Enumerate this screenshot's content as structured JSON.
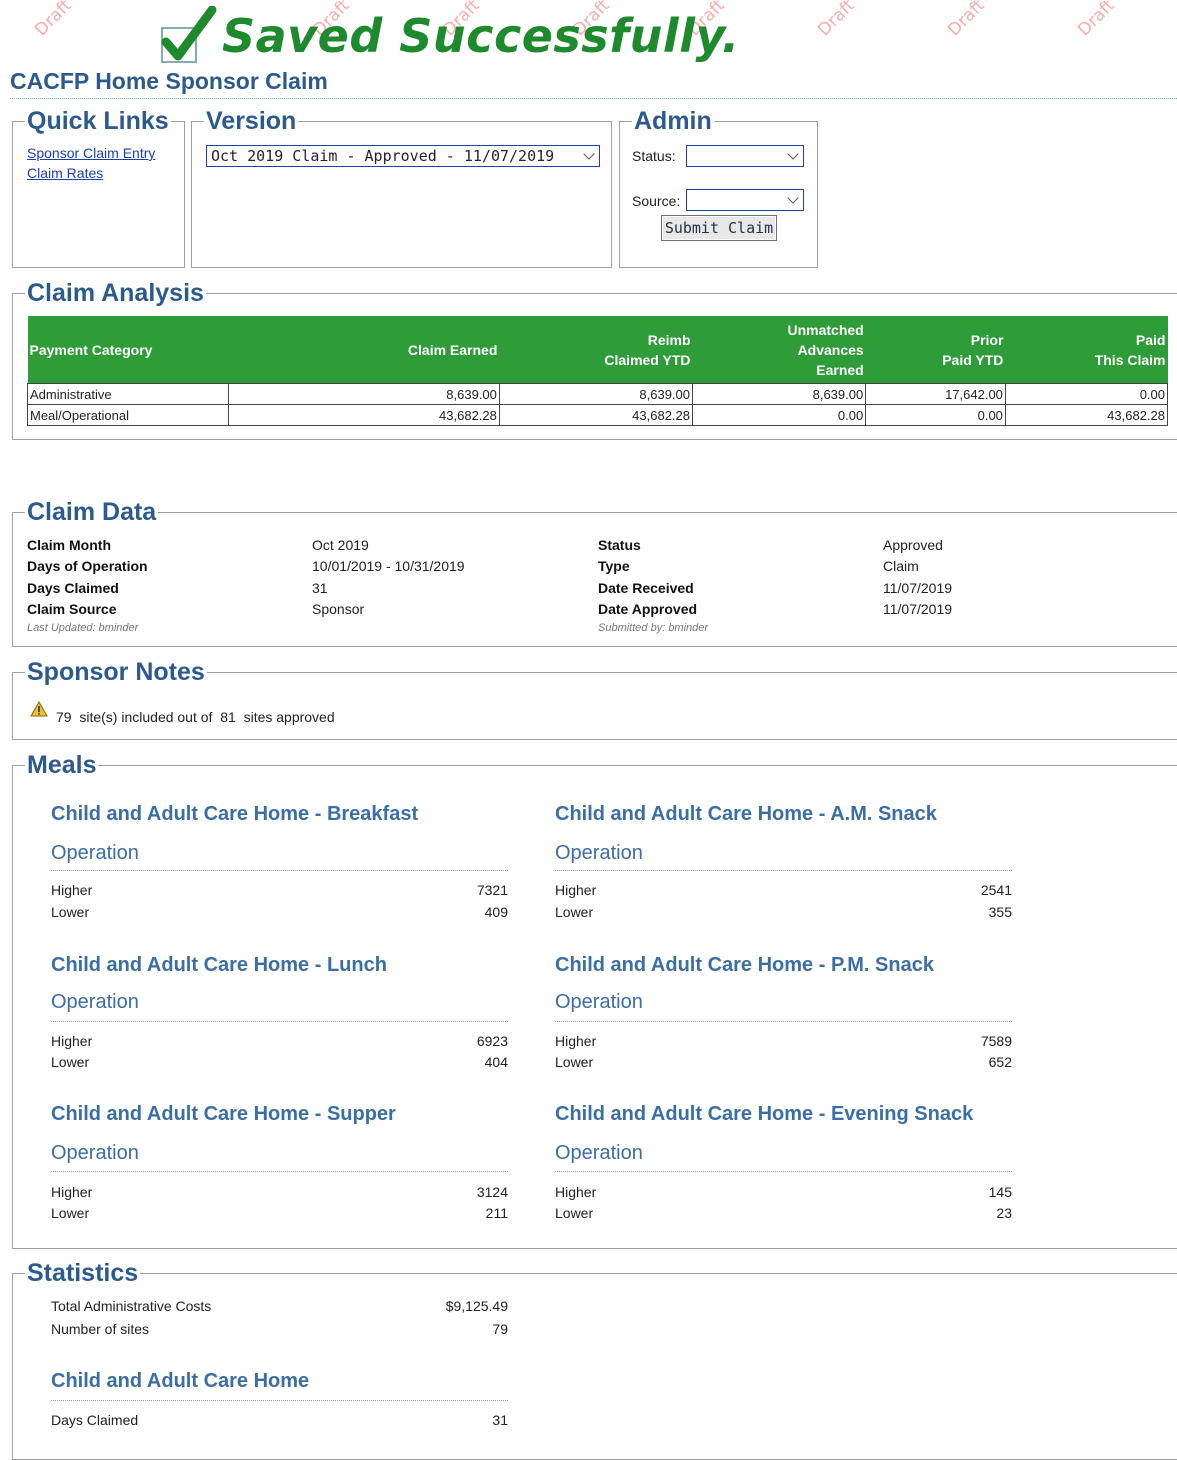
{
  "watermark": "Draft",
  "banner": {
    "message": "Saved Successfully."
  },
  "page": {
    "title": "CACFP Home Sponsor Claim"
  },
  "quick_links": {
    "legend": "Quick Links",
    "links": [
      "Sponsor Claim Entry",
      "Claim Rates"
    ]
  },
  "version": {
    "legend": "Version",
    "selected": "Oct 2019 Claim - Approved - 11/07/2019"
  },
  "admin": {
    "legend": "Admin",
    "status_label": "Status:",
    "status_value": "",
    "source_label": "Source:",
    "source_value": "",
    "submit_label": "Submit Claim"
  },
  "claim_analysis": {
    "legend": "Claim Analysis",
    "header_color": "#2f9c3a",
    "columns": [
      "Payment Category",
      "Claim Earned",
      "Reimb\nClaimed YTD",
      "Unmatched\nAdvances\nEarned",
      "Prior\nPaid YTD",
      "Paid\nThis Claim"
    ],
    "rows": [
      [
        "Administrative",
        "8,639.00",
        "8,639.00",
        "8,639.00",
        "17,642.00",
        "0.00"
      ],
      [
        "Meal/Operational",
        "43,682.28",
        "43,682.28",
        "0.00",
        "0.00",
        "43,682.28"
      ]
    ]
  },
  "claim_data": {
    "legend": "Claim Data",
    "left": [
      {
        "label": "Claim Month",
        "value": "Oct 2019"
      },
      {
        "label": "Days of Operation",
        "value": "10/01/2019 - 10/31/2019"
      },
      {
        "label": "Days Claimed",
        "value": "31"
      },
      {
        "label": "Claim Source",
        "value": "Sponsor"
      }
    ],
    "right": [
      {
        "label": "Status",
        "value": "Approved"
      },
      {
        "label": "Type",
        "value": "Claim"
      },
      {
        "label": "Date Received",
        "value": "11/07/2019"
      },
      {
        "label": "Date Approved",
        "value": "11/07/2019"
      }
    ],
    "last_updated": "Last Updated: bminder",
    "submitted_by": "Submitted by:  bminder"
  },
  "sponsor_notes": {
    "legend": "Sponsor Notes",
    "included": "79",
    "mid_text": "site(s) included out of",
    "approved": "81",
    "end_text": "sites approved"
  },
  "meals": {
    "legend": "Meals",
    "operation_label": "Operation",
    "higher_label": "Higher",
    "lower_label": "Lower",
    "items": [
      {
        "title": "Child and Adult Care Home - Breakfast",
        "higher": "7321",
        "lower": "409"
      },
      {
        "title": "Child and Adult Care Home - A.M. Snack",
        "higher": "2541",
        "lower": "355"
      },
      {
        "title": "Child and Adult Care Home - Lunch",
        "higher": "6923",
        "lower": "404"
      },
      {
        "title": "Child and Adult Care Home - P.M. Snack",
        "higher": "7589",
        "lower": "652"
      },
      {
        "title": "Child and Adult Care Home - Supper",
        "higher": "3124",
        "lower": "211"
      },
      {
        "title": "Child and Adult Care Home - Evening Snack",
        "higher": "145",
        "lower": "23"
      }
    ]
  },
  "statistics": {
    "legend": "Statistics",
    "total_admin_label": "Total Administrative Costs",
    "total_admin_value": "$9,125.49",
    "num_sites_label": "Number of sites",
    "num_sites_value": "79",
    "home_title": "Child and Adult Care Home",
    "days_claimed_label": "Days Claimed",
    "days_claimed_value": "31"
  }
}
